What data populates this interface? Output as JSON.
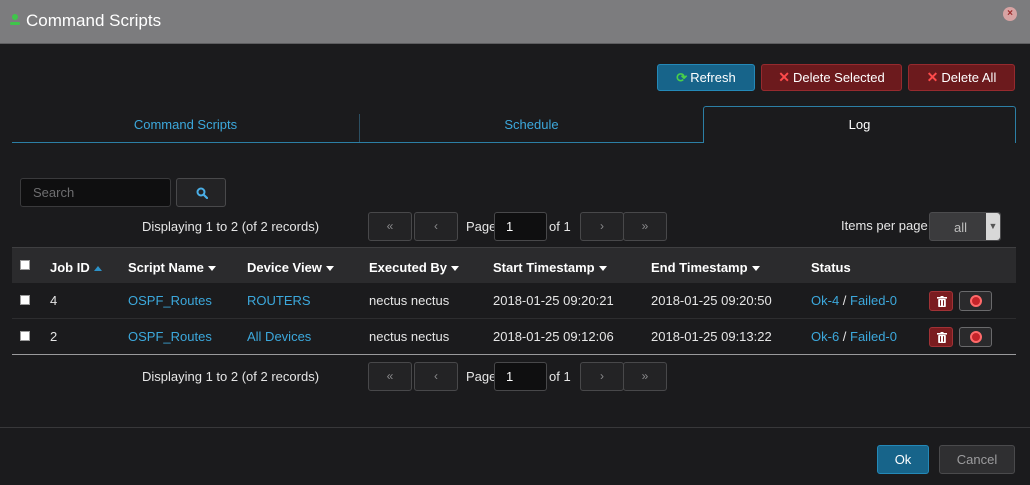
{
  "window": {
    "title": "Command Scripts",
    "close_glyph": "×"
  },
  "toolbar": {
    "refresh_label": "Refresh",
    "delete_selected_label": "Delete Selected",
    "delete_all_label": "Delete All"
  },
  "tabs": [
    {
      "label": "Command Scripts"
    },
    {
      "label": "Schedule"
    },
    {
      "label": "Log",
      "active": true
    }
  ],
  "search": {
    "placeholder": "Search"
  },
  "pagination": {
    "displaying_text": "Displaying 1 to 2 (of 2 records)",
    "first_glyph": "«",
    "prev_glyph": "‹",
    "next_glyph": "›",
    "last_glyph": "»",
    "page_label": "Page",
    "page_value": "1",
    "of_text": "of 1",
    "items_per_page_label": "Items per page",
    "items_per_page_value": "all"
  },
  "table": {
    "headers": {
      "job_id": "Job ID",
      "script_name": "Script Name",
      "device_view": "Device View",
      "executed_by": "Executed By",
      "start_timestamp": "Start Timestamp",
      "end_timestamp": "End Timestamp",
      "status": "Status"
    },
    "rows": [
      {
        "job_id": "4",
        "script_name": "OSPF_Routes",
        "device_view": "ROUTERS",
        "executed_by": "nectus nectus",
        "start_timestamp": "2018-01-25 09:20:21",
        "end_timestamp": "2018-01-25 09:20:50",
        "status_ok": "Ok-4",
        "status_sep": " / ",
        "status_failed": "Failed-0"
      },
      {
        "job_id": "2",
        "script_name": "OSPF_Routes",
        "device_view": "All Devices",
        "executed_by": "nectus nectus",
        "start_timestamp": "2018-01-25 09:12:06",
        "end_timestamp": "2018-01-25 09:13:22",
        "status_ok": "Ok-6",
        "status_sep": " / ",
        "status_failed": "Failed-0"
      }
    ]
  },
  "footer": {
    "ok_label": "Ok",
    "cancel_label": "Cancel"
  },
  "colors": {
    "accent": "#17648a",
    "link": "#3ca8dc",
    "danger": "#6c1a1d",
    "background": "#1b1b1d",
    "titlebar": "#7c7c7e"
  },
  "icons": {
    "title": "green-status-icon",
    "refresh": "refresh-icon",
    "delete": "x-icon",
    "search": "search-icon",
    "trash": "trash-icon",
    "stop": "stop-icon"
  }
}
